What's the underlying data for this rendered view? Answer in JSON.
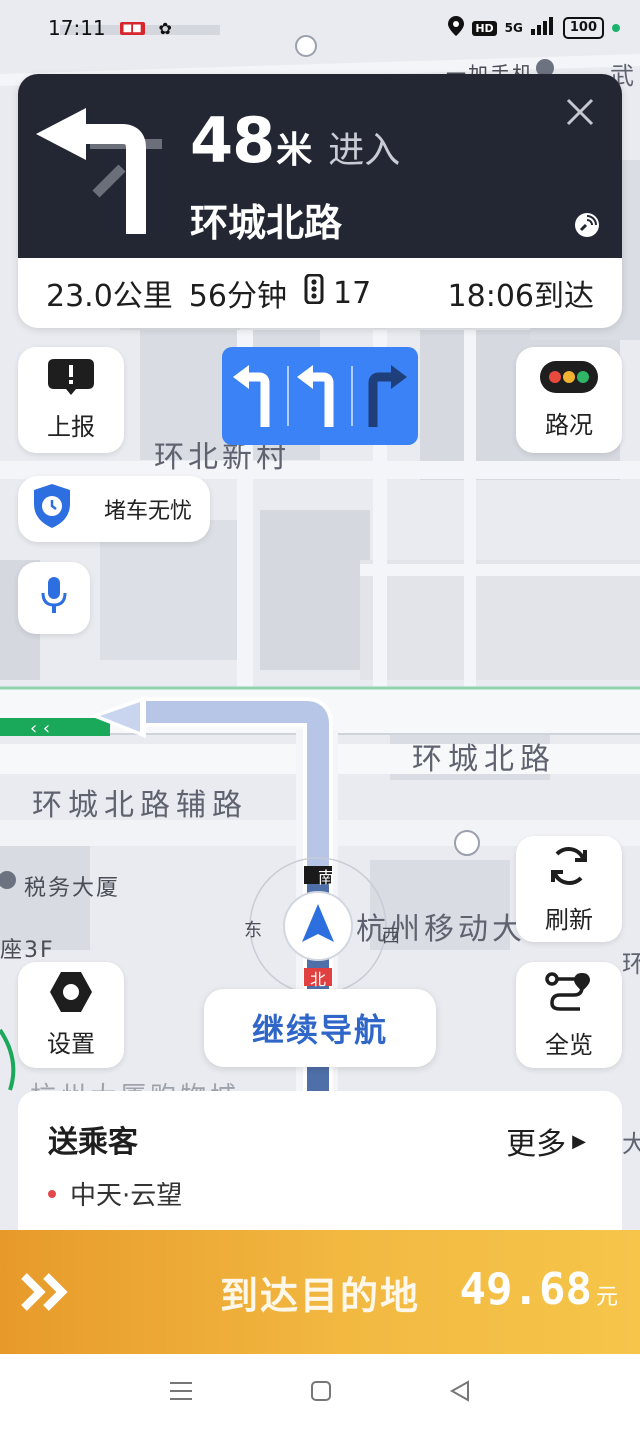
{
  "status_bar": {
    "time": "17:11",
    "hd": "HD",
    "network": "5G",
    "battery": "100"
  },
  "guidance": {
    "distance": "48",
    "unit": "米",
    "action": "进入",
    "road": "环城北路"
  },
  "trip": {
    "distance": "23.0公里",
    "duration": "56分钟",
    "lights": "17",
    "eta": "18:06到达"
  },
  "buttons": {
    "report": "上报",
    "traffic": "路况",
    "jam_free": "堵车无忧",
    "refresh": "刷新",
    "settings": "设置",
    "overview": "全览",
    "continue": "继续导航"
  },
  "map_labels": {
    "road_main": "环城北路",
    "road_aux": "环城北路辅路",
    "community": "环北新村",
    "tax_building": "税务大厦",
    "mobile_building": "杭州移动大",
    "seat": "座3F",
    "phone_shop": "一加手机",
    "compass_s": "南",
    "compass_e": "东",
    "compass_w": "西",
    "compass_n": "北",
    "edge_left": "杭州大厦购物城",
    "edge_top": "武",
    "edge_right": "环",
    "edge_right2": "大"
  },
  "passenger": {
    "title": "送乘客",
    "more": "更多",
    "destination": "中天·云望"
  },
  "arrive": {
    "label": "到达目的地",
    "fare_value": "49.68",
    "fare_unit": "元"
  },
  "colors": {
    "nav_dark": "#232733",
    "lane_blue": "#3a82f6",
    "route_blue": "#2f66c8",
    "arrive_orange": "#f2b941",
    "road_green": "#1aa85a"
  }
}
